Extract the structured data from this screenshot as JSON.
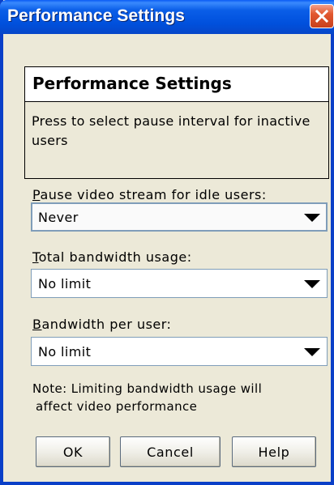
{
  "window": {
    "title": "Performance Settings"
  },
  "header": {
    "title": "Performance Settings",
    "description": "Press to select pause interval for inactive users"
  },
  "fields": [
    {
      "label_first": "P",
      "label_rest": "ause video stream for idle users:",
      "value": "Never"
    },
    {
      "label_first": "T",
      "label_rest": "otal bandwidth usage:",
      "value": "No limit"
    },
    {
      "label_first": "B",
      "label_rest": "andwidth per user:",
      "value": "No limit"
    }
  ],
  "note": {
    "line1": "Note: Limiting bandwidth usage will",
    "line2": "affect video performance"
  },
  "buttons": {
    "ok": "OK",
    "cancel": "Cancel",
    "help": "Help"
  },
  "icons": {
    "close": "close-icon",
    "dropdown": "chevron-down-icon"
  },
  "colors": {
    "titlebar": "#0054e3",
    "close_button": "#e2582f",
    "dialog_background": "#ece9d8"
  }
}
